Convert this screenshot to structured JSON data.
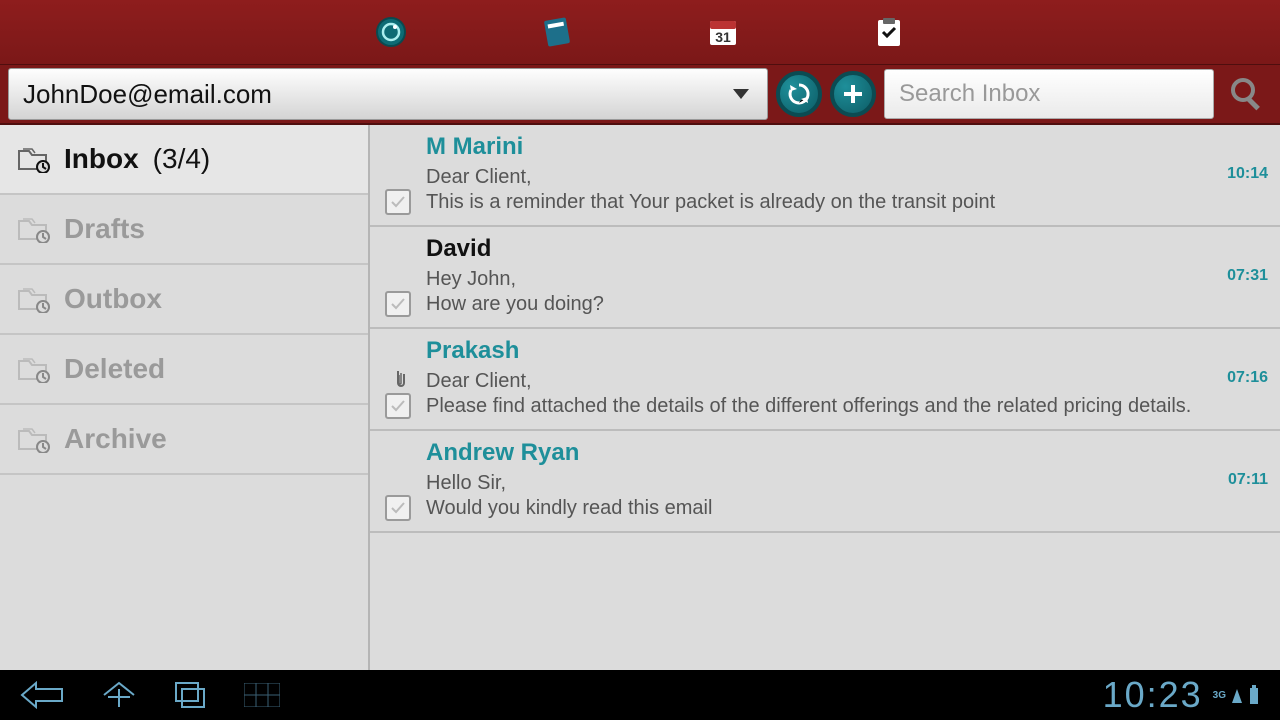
{
  "topbar": {
    "icons": [
      "power-icon",
      "diary-icon",
      "calendar-icon",
      "checklist-icon"
    ],
    "calendar_day": "31"
  },
  "account": {
    "email": "JohnDoe@email.com"
  },
  "actions": {
    "refresh": "↻",
    "compose": "+"
  },
  "search": {
    "placeholder": "Search Inbox"
  },
  "folders": [
    {
      "id": "inbox",
      "label": "Inbox",
      "count": "(3/4)",
      "active": true
    },
    {
      "id": "drafts",
      "label": "Drafts",
      "count": "",
      "active": false
    },
    {
      "id": "outbox",
      "label": "Outbox",
      "count": "",
      "active": false
    },
    {
      "id": "deleted",
      "label": "Deleted",
      "count": "",
      "active": false
    },
    {
      "id": "archive",
      "label": "Archive",
      "count": "",
      "active": false
    }
  ],
  "messages": [
    {
      "sender": "M Marini",
      "unread": true,
      "attachment": false,
      "preview": "Dear Client,\nThis is a reminder that Your packet is already on the transit point",
      "time": "10:14"
    },
    {
      "sender": "David",
      "unread": false,
      "attachment": false,
      "preview": "Hey John,\nHow are you doing?",
      "time": "07:31"
    },
    {
      "sender": "Prakash",
      "unread": true,
      "attachment": true,
      "preview": "Dear Client,\nPlease find attached the details of the different offerings and the related pricing details.",
      "time": "07:16"
    },
    {
      "sender": "Andrew Ryan",
      "unread": true,
      "attachment": false,
      "preview": "Hello Sir,\nWould you kindly read this email",
      "time": "07:11"
    }
  ],
  "sysbar": {
    "clock": "10:23",
    "signal": "3G"
  }
}
